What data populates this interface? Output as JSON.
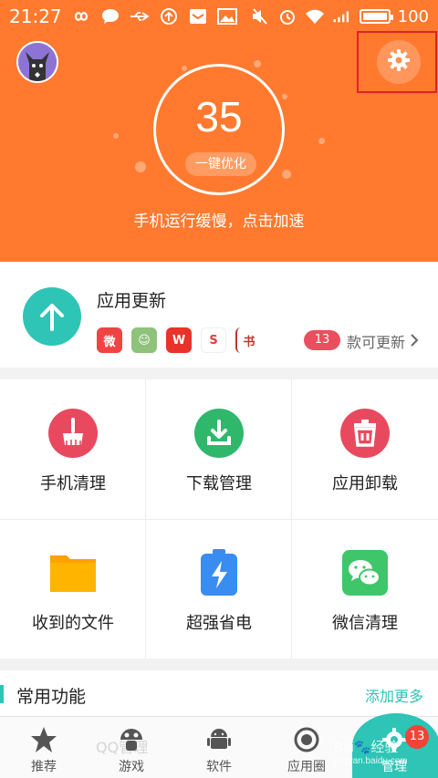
{
  "status_bar": {
    "time": "21:27",
    "battery_level": "100",
    "icons": [
      "infinity-icon",
      "chat-icon",
      "usb-icon",
      "sync-icon",
      "mail-icon",
      "image-icon",
      "mute-icon",
      "alarm-icon",
      "wifi-icon",
      "signal-icon"
    ]
  },
  "header": {
    "score": "35",
    "optimize_label": "一键优化",
    "hint": "手机运行缓慢，点击加速",
    "background_color": "#ff7a2f"
  },
  "update": {
    "title": "应用更新",
    "app_icons": [
      {
        "name": "weibo-app-icon",
        "color": "#f04444",
        "glyph": "微"
      },
      {
        "name": "cartoon-app-icon",
        "color": "#8fc27b",
        "glyph": "☺"
      },
      {
        "name": "wps-app-icon",
        "color": "#e8332a",
        "glyph": "W"
      },
      {
        "name": "s-app-icon",
        "color": "#ffffff",
        "glyph": "S"
      },
      {
        "name": "book-app-icon",
        "color": "#ffffff",
        "glyph": "书"
      }
    ],
    "count": "13",
    "count_text": "款可更新"
  },
  "tools": [
    {
      "label": "手机清理",
      "icon": "broom-icon",
      "color": "#e9495e"
    },
    {
      "label": "下载管理",
      "icon": "download-icon",
      "color": "#2fb86c"
    },
    {
      "label": "应用卸载",
      "icon": "trash-icon",
      "color": "#e9495e"
    },
    {
      "label": "收到的文件",
      "icon": "folder-icon",
      "color": "#ffb400"
    },
    {
      "label": "超强省电",
      "icon": "battery-bolt-icon",
      "color": "#3a8df0"
    },
    {
      "label": "微信清理",
      "icon": "wechat-icon",
      "color": "#3fc66b"
    }
  ],
  "common": {
    "title": "常用功能",
    "more": "添加更多"
  },
  "nav": {
    "items": [
      {
        "label": "推荐",
        "icon": "star-icon"
      },
      {
        "label": "游戏",
        "icon": "mushroom-icon"
      },
      {
        "label": "软件",
        "icon": "android-icon"
      },
      {
        "label": "应用圈",
        "icon": "circle-icon"
      },
      {
        "label": "管理",
        "icon": "gear-icon"
      }
    ],
    "badge": "13",
    "ghost_text": "QQ管理"
  },
  "accent_color": "#2ec4b6"
}
